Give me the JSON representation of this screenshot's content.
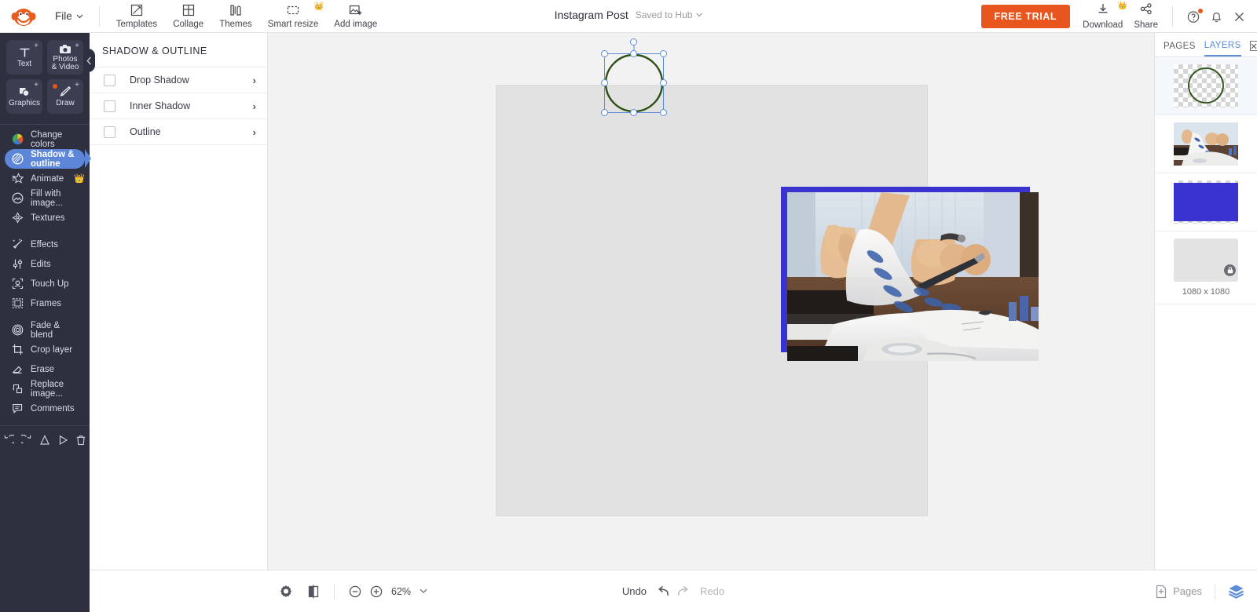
{
  "app": {
    "logo": "monkey-logo",
    "file_menu": "File"
  },
  "topbar": {
    "tools": [
      {
        "label": "Templates",
        "icon": "templates-icon",
        "pro": false
      },
      {
        "label": "Collage",
        "icon": "collage-icon",
        "pro": false
      },
      {
        "label": "Themes",
        "icon": "themes-icon",
        "pro": false
      },
      {
        "label": "Smart resize",
        "icon": "smart-resize-icon",
        "pro": true
      },
      {
        "label": "Add image",
        "icon": "add-image-icon",
        "pro": false
      }
    ],
    "document_title": "Instagram Post",
    "saved_status": "Saved to Hub",
    "free_trial": "FREE TRIAL",
    "download": "Download",
    "share": "Share",
    "help_icon": "help-circle-icon",
    "bell_icon": "bell-icon",
    "close_icon": "close-icon"
  },
  "rail": {
    "big_buttons": [
      {
        "label": "Text",
        "icon": "text-icon",
        "plus": "+",
        "dot": false
      },
      {
        "label": "Photos\n& Video",
        "label_line1": "Photos",
        "label_line2": "& Video",
        "icon": "camera-icon",
        "plus": "+",
        "dot": false
      },
      {
        "label": "Graphics",
        "icon": "graphics-icon",
        "plus": "+",
        "dot": false
      },
      {
        "label": "Draw",
        "icon": "draw-icon",
        "plus": "+",
        "dot": true
      }
    ],
    "menu": [
      {
        "label": "Change colors",
        "icon": "color-wheel-icon",
        "active": false,
        "crown": false
      },
      {
        "label": "Shadow & outline",
        "icon": "shadow-outline-icon",
        "active": true,
        "crown": false
      },
      {
        "label": "Animate",
        "icon": "animate-icon",
        "active": false,
        "crown": true
      },
      {
        "label": "Fill with image...",
        "icon": "fill-image-icon",
        "active": false,
        "crown": false
      },
      {
        "label": "Textures",
        "icon": "textures-icon",
        "active": false,
        "crown": false
      },
      {
        "label": "Effects",
        "icon": "effects-icon",
        "active": false,
        "crown": false
      },
      {
        "label": "Edits",
        "icon": "edits-sliders-icon",
        "active": false,
        "crown": false
      },
      {
        "label": "Touch Up",
        "icon": "touch-up-icon",
        "active": false,
        "crown": false
      },
      {
        "label": "Frames",
        "icon": "frames-icon",
        "active": false,
        "crown": false
      },
      {
        "label": "Fade & blend",
        "icon": "fade-blend-icon",
        "active": false,
        "crown": false
      },
      {
        "label": "Crop layer",
        "icon": "crop-icon",
        "active": false,
        "crown": false
      },
      {
        "label": "Erase",
        "icon": "eraser-icon",
        "active": false,
        "crown": false
      },
      {
        "label": "Replace image...",
        "icon": "replace-image-icon",
        "active": false,
        "crown": false
      },
      {
        "label": "Comments",
        "icon": "comment-icon",
        "active": false,
        "crown": false
      }
    ],
    "bottom_tools": [
      {
        "icon": "undo-icon"
      },
      {
        "icon": "redo-icon"
      },
      {
        "icon": "flip-icon"
      },
      {
        "icon": "play-icon"
      },
      {
        "icon": "trash-icon"
      }
    ],
    "collapse_icon": "chevron-left-icon",
    "crown_glyph": "👑",
    "plus_glyph": "+"
  },
  "panel": {
    "title": "SHADOW & OUTLINE",
    "options": [
      {
        "label": "Drop Shadow",
        "checked": false,
        "arrow": "›"
      },
      {
        "label": "Inner Shadow",
        "checked": false,
        "arrow": "›"
      },
      {
        "label": "Outline",
        "checked": false,
        "arrow": "›"
      }
    ]
  },
  "canvas": {
    "selected_layer": "circle-outline-shape",
    "shape_stroke_color": "#2d5016",
    "photo_accent_color": "#3a33cf",
    "artboard_bg": "#e2e2e2",
    "stage_bg": "#f2f2f3"
  },
  "right_panel": {
    "tabs": [
      {
        "label": "PAGES",
        "active": false
      },
      {
        "label": "LAYERS",
        "active": true
      }
    ],
    "close_icon": "close-box-icon",
    "layers": [
      {
        "name": "circle-outline-layer",
        "type": "shape",
        "selected": true,
        "locked": false
      },
      {
        "name": "photo-layer",
        "type": "photo",
        "selected": false,
        "locked": false
      },
      {
        "name": "blue-rectangle-layer",
        "type": "rect",
        "selected": false,
        "locked": false,
        "color": "#3a33cf"
      },
      {
        "name": "background-layer",
        "type": "background",
        "selected": false,
        "locked": true,
        "caption": "1080 x 1080"
      }
    ]
  },
  "bottombar": {
    "settings_icon": "gear-icon",
    "compare_icon": "compare-icon",
    "zoom_out_icon": "zoom-out-icon",
    "zoom_in_icon": "zoom-in-icon",
    "zoom_value": "62%",
    "zoom_caret": "∨",
    "undo_label": "Undo",
    "redo_label": "Redo",
    "pages_label": "Pages",
    "add_page_icon": "add-page-icon",
    "layers_icon": "layers-stack-icon"
  }
}
